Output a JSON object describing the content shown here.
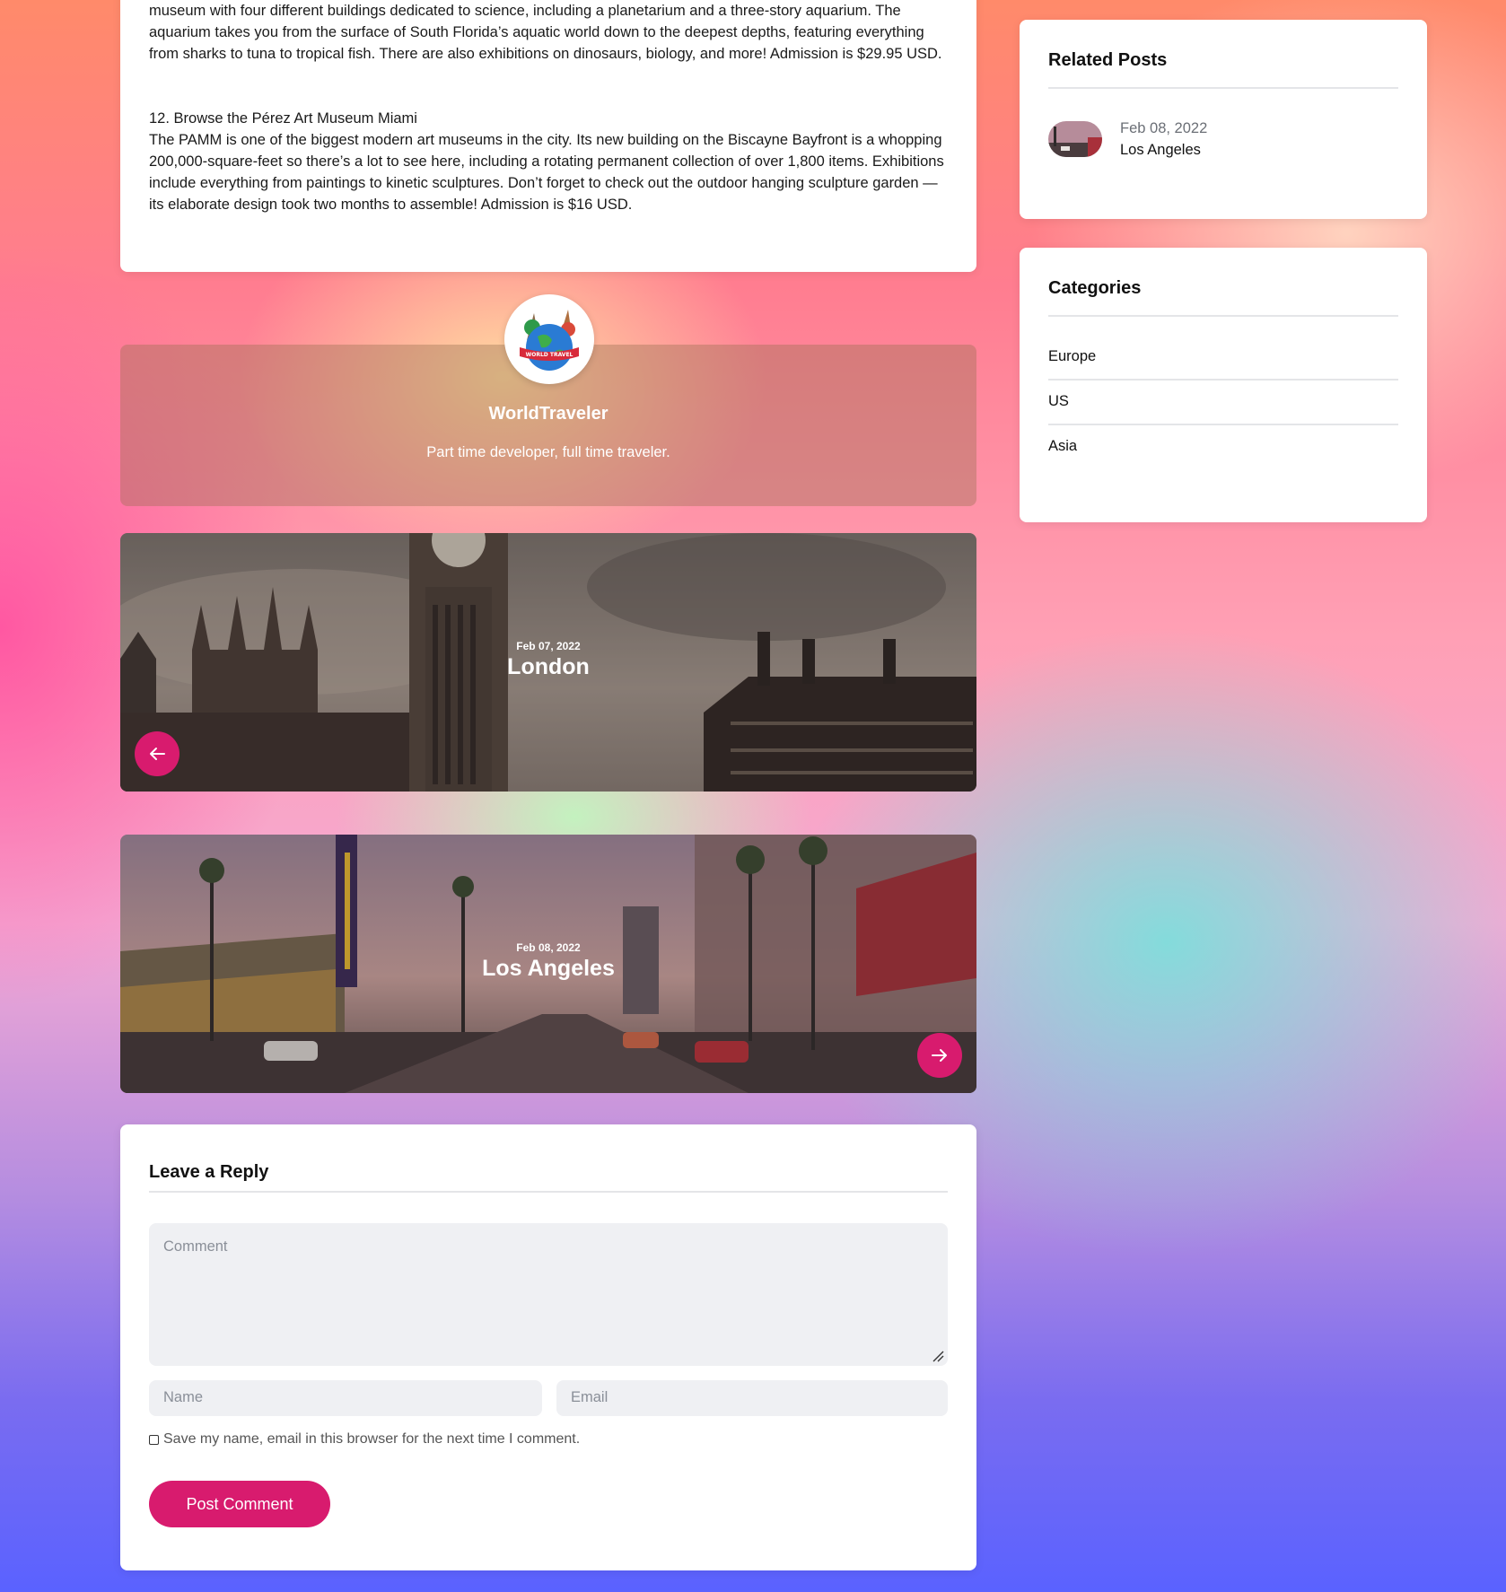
{
  "article": {
    "paragraph1": "museum with four different buildings dedicated to science, including a planetarium and a three-story aquarium. The aquarium takes you from the surface of South Florida’s aquatic world down to the deepest depths, featuring everything from sharks to tuna to tropical fish. There are also exhibitions on dinosaurs, biology, and more! Admission is $29.95 USD.",
    "heading12": "12. Browse the Pérez Art Museum Miami",
    "paragraph2": "The PAMM is one of the biggest modern art museums in the city. Its new building on the Biscayne Bayfront is a whopping 200,000-square-feet so there’s a lot to see here, including a rotating permanent collection of over 1,800 items. Exhibitions include everything from paintings to kinetic sculptures. Don’t forget to check out the outdoor hanging sculpture garden — its elaborate design took two months to assemble! Admission is $16 USD."
  },
  "author": {
    "name": "WorldTraveler",
    "bio": "Part time developer, full time traveler.",
    "avatar_text": "WORLD TRAVEL"
  },
  "prev_post": {
    "date": "Feb 07, 2022",
    "title": "London",
    "icon": "arrow-left-icon"
  },
  "next_post": {
    "date": "Feb 08, 2022",
    "title": "Los Angeles",
    "icon": "arrow-right-icon"
  },
  "reply": {
    "title": "Leave a Reply",
    "comment_placeholder": "Comment",
    "name_placeholder": "Name",
    "email_placeholder": "Email",
    "save_label": "Save my name, email in this browser for the next time I comment.",
    "submit_label": "Post Comment"
  },
  "sidebar": {
    "related": {
      "title": "Related Posts",
      "items": [
        {
          "date": "Feb 08, 2022",
          "title": "Los Angeles"
        }
      ]
    },
    "categories": {
      "title": "Categories",
      "items": [
        "Europe",
        "US",
        "Asia"
      ]
    }
  },
  "colors": {
    "accent": "#d81b6e"
  }
}
